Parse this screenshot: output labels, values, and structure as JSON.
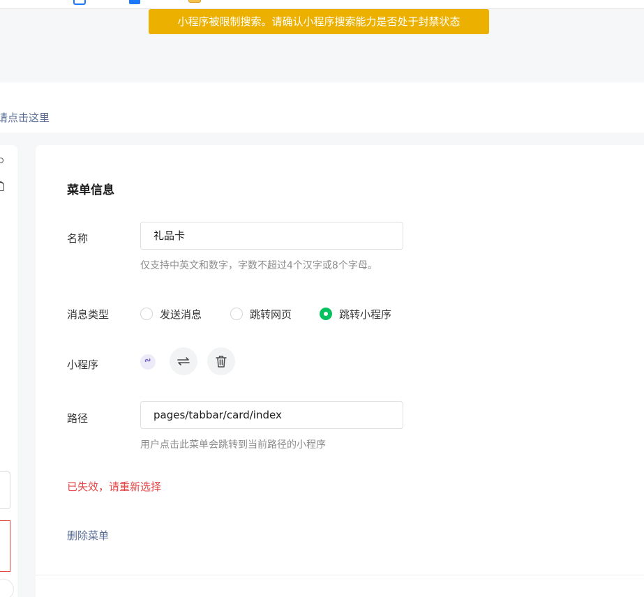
{
  "notice_banner": {
    "text": "小程序被限制搜索。请确认小程序搜索能力是否处于封禁状态"
  },
  "hint_link": "请点击这里",
  "menu_info": {
    "title": "菜单信息",
    "name_field": {
      "label": "名称",
      "value": "礼品卡",
      "tip": "仅支持中英文和数字，字数不超过4个汉字或8个字母。"
    },
    "message_type": {
      "label": "消息类型",
      "options": [
        {
          "label": "发送消息",
          "selected": false
        },
        {
          "label": "跳转网页",
          "selected": false
        },
        {
          "label": "跳转小程序",
          "selected": true
        }
      ]
    },
    "mini_program": {
      "label": "小程序",
      "icons": [
        "mini-program-icon",
        "switch-icon",
        "trash-icon"
      ]
    },
    "path_field": {
      "label": "路径",
      "value": "pages/tabbar/card/index",
      "tip": "用户点击此菜单会跳转到当前路径的小程序"
    },
    "error_text": "已失效，请重新选择",
    "delete_menu": "删除菜单"
  },
  "colors": {
    "notice_bg": "#ebb000",
    "selected_radio": "#07c160",
    "link": "#576b95",
    "error": "#e54545"
  }
}
